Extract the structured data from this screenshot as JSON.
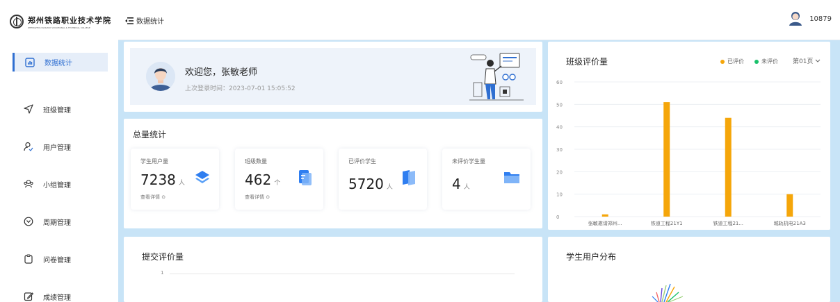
{
  "sidebar": {
    "logo_cn": "郑州铁路职业技术学院",
    "logo_en": "ZHENGZHOU RAILWAY VOCATIONAL & TECHNICAL COLLEGE",
    "items": [
      {
        "label": "数据统计",
        "icon": "chart-icon"
      },
      {
        "label": "班级管理",
        "icon": "send-icon"
      },
      {
        "label": "用户管理",
        "icon": "user-icon"
      },
      {
        "label": "小组管理",
        "icon": "group-icon"
      },
      {
        "label": "周期管理",
        "icon": "cycle-icon"
      },
      {
        "label": "问卷管理",
        "icon": "clipboard-icon"
      },
      {
        "label": "成绩管理",
        "icon": "edit-icon"
      }
    ]
  },
  "header": {
    "breadcrumb": "数据统计",
    "username": "10879"
  },
  "welcome": {
    "greeting": "欢迎您，张敏老师",
    "last_login": "上次登录时间：2023-07-01 15:05:52"
  },
  "totals": {
    "title": "总量统计",
    "cards": [
      {
        "label": "学生用户量",
        "value": "7238",
        "unit": "人",
        "link": "查看详情 ⊙"
      },
      {
        "label": "班级数量",
        "value": "462",
        "unit": "个",
        "link": "查看详情 ⊙"
      },
      {
        "label": "已评价学生",
        "value": "5720",
        "unit": "人"
      },
      {
        "label": "未评价学生量",
        "value": "4",
        "unit": "人"
      }
    ]
  },
  "submit_chart": {
    "title": "提交评价量",
    "tick": "1"
  },
  "class_chart": {
    "title": "班级评价量",
    "legend": [
      {
        "label": "已评价",
        "color": "#f5a60a"
      },
      {
        "label": "未评价",
        "color": "#19c16b"
      }
    ],
    "pager": "第01页"
  },
  "distribution": {
    "title": "学生用户分布"
  },
  "colors": {
    "accent": "#2f6fd1",
    "bar": "#f5a60a",
    "unrated": "#19c16b"
  },
  "chart_data": {
    "type": "bar",
    "categories": [
      "张敏邀请郑州...",
      "铁道工程21Y1",
      "铁道工程21...",
      "城轨机电21A3"
    ],
    "series": [
      {
        "name": "已评价",
        "values": [
          1,
          51,
          44,
          10
        ]
      },
      {
        "name": "未评价",
        "values": [
          0,
          0,
          0,
          0
        ]
      }
    ],
    "ylim": [
      0,
      60
    ],
    "yticks": [
      0,
      10,
      20,
      30,
      40,
      50,
      60
    ],
    "grid": true,
    "legend_position": "top-right"
  }
}
